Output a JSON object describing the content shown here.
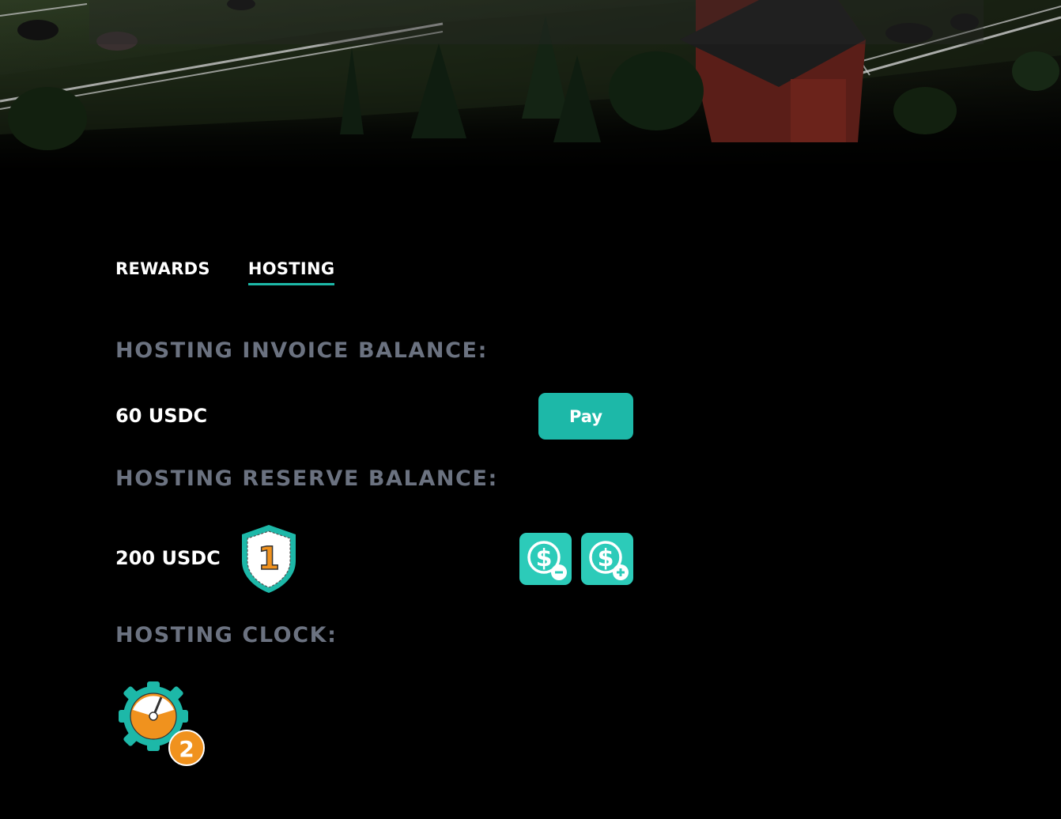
{
  "tabs": [
    {
      "label": "REWARDS",
      "active": false
    },
    {
      "label": "HOSTING",
      "active": true
    }
  ],
  "invoice": {
    "label": "HOSTING INVOICE BALANCE:",
    "value": "60 USDC",
    "pay_label": "Pay"
  },
  "reserve": {
    "label": "HOSTING RESERVE BALANCE:",
    "value": "200 USDC",
    "shield_level": "1",
    "withdraw_icon": "dollar-minus-icon",
    "deposit_icon": "dollar-plus-icon"
  },
  "clock": {
    "label": "HOSTING CLOCK:",
    "level": "2"
  },
  "colors": {
    "accent": "#1db8a8",
    "label_gray": "#6b7280",
    "orange": "#f0921e"
  }
}
